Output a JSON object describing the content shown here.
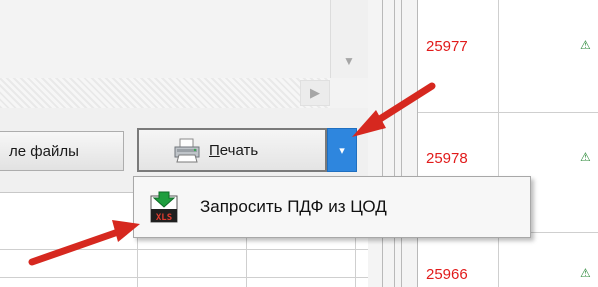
{
  "toolbar": {
    "files_label": "ле файлы",
    "print_label_underlined": "П",
    "print_label_rest": "ечать",
    "dropdown_glyph": "▾"
  },
  "menu": {
    "items": [
      {
        "label": "Запросить ПДФ из ЦОД",
        "icon": "xls-export-icon"
      }
    ]
  },
  "table": {
    "rows": [
      {
        "number": "25977"
      },
      {
        "number": "25978"
      },
      {
        "number": "25966"
      }
    ],
    "status_glyph": "⚠"
  },
  "scrollbars": {
    "down_glyph": "▼",
    "right_glyph": "▶"
  },
  "colors": {
    "accent": "#2e86de",
    "number_red": "#e11b1b",
    "arrow_red": "#d6281f"
  }
}
